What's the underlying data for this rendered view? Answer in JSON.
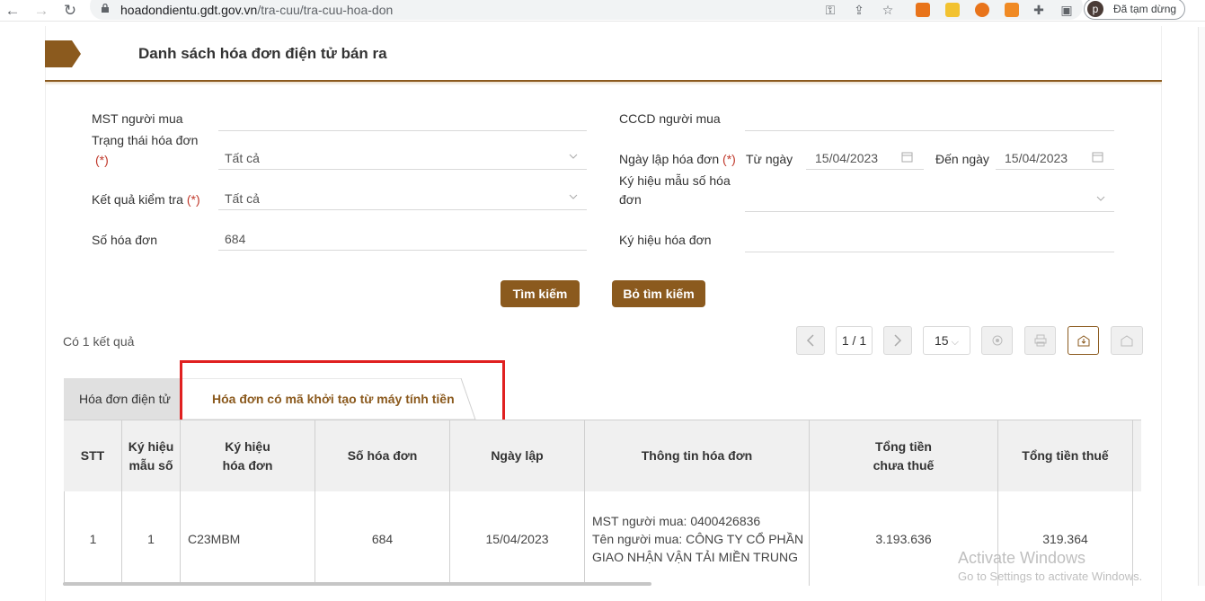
{
  "browser": {
    "url_host": "hoadondientu.gdt.gov.vn",
    "url_path": "/tra-cuu/tra-cuu-hoa-don",
    "profile_initial": "p",
    "profile_status": "Đã tạm dừng"
  },
  "page": {
    "title": "Danh sách hóa đơn điện tử bán ra"
  },
  "form": {
    "mst_label": "MST người mua",
    "mst_value": "",
    "status_label": "Trạng thái hóa đơn",
    "status_req": "(*)",
    "status_value": "Tất cả",
    "result_check_label": "Kết quả kiểm tra",
    "result_check_req": "(*)",
    "result_check_value": "Tất cả",
    "invoice_no_label": "Số hóa đơn",
    "invoice_no_value": "684",
    "cccd_label": "CCCD người mua",
    "cccd_value": "",
    "date_label": "Ngày lập hóa đơn",
    "date_req": "(*)",
    "from_label": "Từ ngày",
    "from_value": "15/04/2023",
    "to_label": "Đến ngày",
    "to_value": "15/04/2023",
    "template_label_1": "Ký hiệu mẫu số hóa",
    "template_label_2": "đơn",
    "template_value": "",
    "symbol_label": "Ký hiệu hóa đơn",
    "symbol_value": ""
  },
  "buttons": {
    "search": "Tìm kiếm",
    "clear": "Bỏ tìm kiếm"
  },
  "results": {
    "count_text": "Có 1 kết quả"
  },
  "pagination": {
    "page_text": "1 / 1",
    "page_size": "15"
  },
  "tabs": [
    {
      "label": "Hóa đơn điện tử"
    },
    {
      "label": "Hóa đơn có mã khởi tạo từ máy tính tiền"
    }
  ],
  "table": {
    "headers": [
      {
        "l1": "STT",
        "l2": ""
      },
      {
        "l1": "Ký hiệu",
        "l2": "mẫu số"
      },
      {
        "l1": "Ký hiệu",
        "l2": "hóa đơn"
      },
      {
        "l1": "Số hóa đơn",
        "l2": ""
      },
      {
        "l1": "Ngày lập",
        "l2": ""
      },
      {
        "l1": "Thông tin hóa đơn",
        "l2": ""
      },
      {
        "l1": "Tổng tiền",
        "l2": "chưa thuế"
      },
      {
        "l1": "Tổng tiền thuế",
        "l2": ""
      }
    ],
    "rows": [
      {
        "stt": "1",
        "mau_so": "1",
        "ky_hieu": "C23MBM",
        "so_hd": "684",
        "ngay_lap": "15/04/2023",
        "info_1": "MST người mua: 0400426836",
        "info_2": "Tên người mua: CÔNG TY CỔ PHẦN",
        "info_3": "GIAO NHẬN VẬN TẢI MIỀN TRUNG",
        "tong_chua_thue": "3.193.636",
        "tong_thue": "319.364"
      }
    ]
  },
  "watermark": {
    "line1": "Activate Windows",
    "line2": "Go to Settings to activate Windows."
  }
}
